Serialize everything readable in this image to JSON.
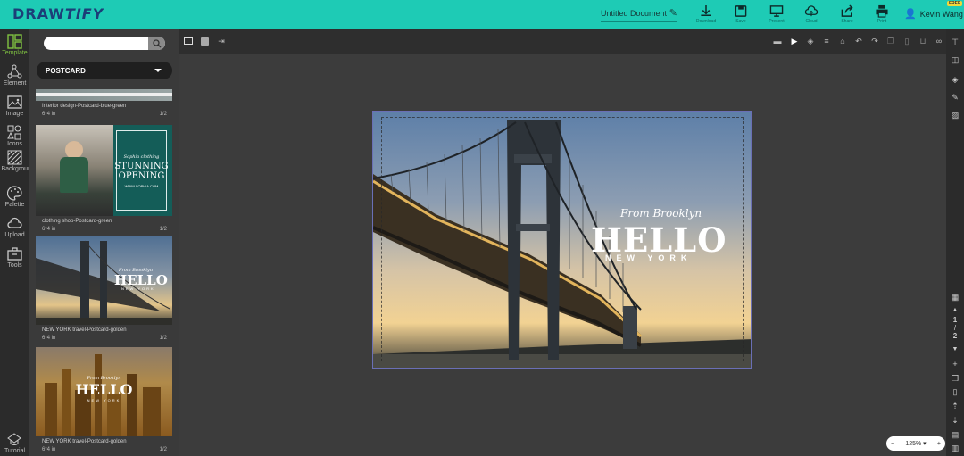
{
  "app": {
    "logo_a": "DRAW",
    "logo_b": "TIFY",
    "doc_title": "Untitled Document",
    "user_name": "Kevin Wang",
    "badge": "FREE"
  },
  "toolbar": {
    "download": "Download",
    "save": "Save",
    "present": "Present",
    "cloud": "Cloud",
    "share": "Share",
    "print": "Print"
  },
  "left_rail": [
    {
      "label": "Template",
      "icon": "template-icon"
    },
    {
      "label": "Element",
      "icon": "element-icon"
    },
    {
      "label": "Image",
      "icon": "image-icon"
    },
    {
      "label": "Icons",
      "icon": "icons-icon"
    },
    {
      "label": "Background",
      "icon": "background-icon"
    },
    {
      "label": "Palette",
      "icon": "palette-icon"
    },
    {
      "label": "Upload",
      "icon": "upload-icon"
    },
    {
      "label": "Tools",
      "icon": "tools-icon"
    },
    {
      "label": "Tutorial",
      "icon": "tutorial-icon"
    }
  ],
  "panel": {
    "search_placeholder": "",
    "category": "POSTCARD",
    "templates": [
      {
        "name": "Interior design-Postcard-blue-green",
        "size": "6*4 in",
        "pages": "1/2"
      },
      {
        "name": "clothing shop-Postcard-green",
        "size": "6*4 in",
        "pages": "1/2",
        "t1": "Sophia clothing",
        "t2": "STUNNING",
        "t3": "OPENING",
        "t4": "WWW.SOPHIA.COM"
      },
      {
        "name": "NEW YORK travel-Postcard-golden",
        "size": "6*4 in",
        "pages": "1/2",
        "t1": "From Brooklyn",
        "t2": "HELLO",
        "t3": "NEW YORK"
      },
      {
        "name": "NEW YORK travel-Postcard-golden",
        "size": "6*4 in",
        "pages": "1/2",
        "t1": "From Brooklyn",
        "t2": "HELLO",
        "t3": "NEW YORK"
      }
    ]
  },
  "canvas": {
    "from": "From Brooklyn",
    "hello": "HELLO",
    "ny": "NEW YORK"
  },
  "page_nav": {
    "current": "1",
    "sep": "/",
    "total": "2"
  },
  "zoom": {
    "minus": "−",
    "value": "125%",
    "caret": "▾",
    "plus": "+"
  }
}
